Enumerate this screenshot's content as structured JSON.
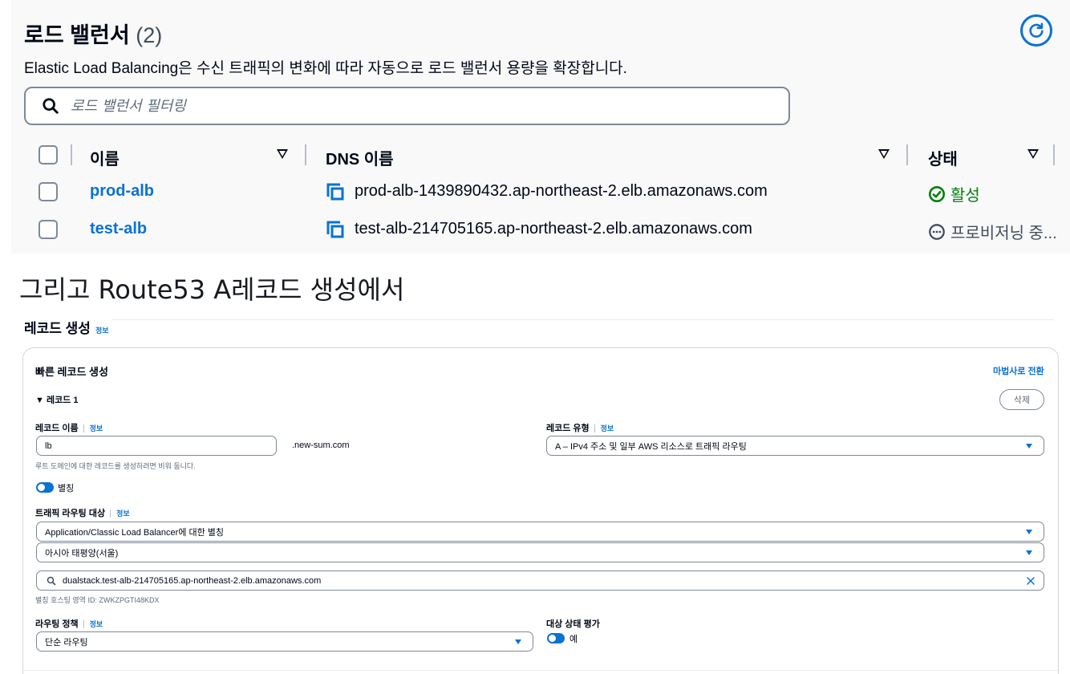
{
  "load_balancers": {
    "title": "로드 밸런서",
    "count": "(2)",
    "description": "Elastic Load Balancing은 수신 트래픽의 변화에 따라 자동으로 로드 밸런서 용량을 확장합니다.",
    "search_placeholder": "로드 밸런서 필터링",
    "columns": {
      "name": "이름",
      "dns": "DNS 이름",
      "status": "상태"
    },
    "rows": [
      {
        "name": "prod-alb",
        "dns": "prod-alb-1439890432.ap-northeast-2.elb.amazonaws.com",
        "status": "활성",
        "status_icon": "check-circle-icon",
        "status_color": "#037f0c"
      },
      {
        "name": "test-alb",
        "dns": "test-alb-214705165.ap-northeast-2.elb.amazonaws.com",
        "status": "프로비저닝 중...",
        "status_icon": "ellipsis-circle-icon",
        "status_color": "#414d5c"
      }
    ]
  },
  "caption": "그리고 Route53 A레코드 생성에서",
  "route53": {
    "title": "레코드 생성",
    "info": "정보",
    "card_title": "빠른 레코드 생성",
    "wizard_link": "마법사로 전환",
    "record_section": "▼ 레코드 1",
    "delete_button": "삭제",
    "record_name_label": "레코드 이름",
    "record_name_value": "lb",
    "domain_suffix": ".new-sum.com",
    "record_name_hint": "루트 도메인에 대한 레코드를 생성하려면 비워 둡니다.",
    "record_type_label": "레코드 유형",
    "record_type_value": "A – IPv4 주소 및 일부 AWS 리소스로 트래픽 라우팅",
    "alias_label": "별칭",
    "target_label": "트래픽 라우팅 대상",
    "target_type_value": "Application/Classic Load Balancer에 대한 별칭",
    "region_value": "아시아 태평양(서울)",
    "lb_value": "dualstack.test-alb-214705165.ap-northeast-2.elb.amazonaws.com",
    "hosted_zone": "별칭 호스팅 영역 ID: ZWKZPGTI48KDX",
    "routing_policy_label": "라우팅 정책",
    "routing_policy_value": "단순 라우팅",
    "health_label": "대상 상태 평가",
    "health_value": "예"
  },
  "colors": {
    "accent": "#0972d3",
    "success": "#037f0c",
    "text": "#000716"
  }
}
